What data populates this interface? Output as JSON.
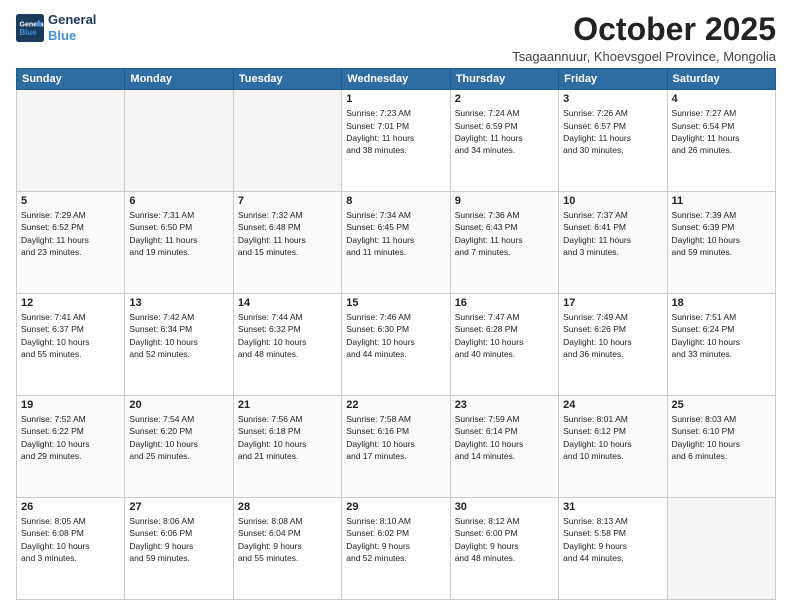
{
  "header": {
    "logo_line1": "General",
    "logo_line2": "Blue",
    "month_title": "October 2025",
    "location": "Tsagaannuur, Khoevsgoel Province, Mongolia"
  },
  "weekdays": [
    "Sunday",
    "Monday",
    "Tuesday",
    "Wednesday",
    "Thursday",
    "Friday",
    "Saturday"
  ],
  "weeks": [
    [
      {
        "day": "",
        "info": ""
      },
      {
        "day": "",
        "info": ""
      },
      {
        "day": "",
        "info": ""
      },
      {
        "day": "1",
        "info": "Sunrise: 7:23 AM\nSunset: 7:01 PM\nDaylight: 11 hours\nand 38 minutes."
      },
      {
        "day": "2",
        "info": "Sunrise: 7:24 AM\nSunset: 6:59 PM\nDaylight: 11 hours\nand 34 minutes."
      },
      {
        "day": "3",
        "info": "Sunrise: 7:26 AM\nSunset: 6:57 PM\nDaylight: 11 hours\nand 30 minutes."
      },
      {
        "day": "4",
        "info": "Sunrise: 7:27 AM\nSunset: 6:54 PM\nDaylight: 11 hours\nand 26 minutes."
      }
    ],
    [
      {
        "day": "5",
        "info": "Sunrise: 7:29 AM\nSunset: 6:52 PM\nDaylight: 11 hours\nand 23 minutes."
      },
      {
        "day": "6",
        "info": "Sunrise: 7:31 AM\nSunset: 6:50 PM\nDaylight: 11 hours\nand 19 minutes."
      },
      {
        "day": "7",
        "info": "Sunrise: 7:32 AM\nSunset: 6:48 PM\nDaylight: 11 hours\nand 15 minutes."
      },
      {
        "day": "8",
        "info": "Sunrise: 7:34 AM\nSunset: 6:45 PM\nDaylight: 11 hours\nand 11 minutes."
      },
      {
        "day": "9",
        "info": "Sunrise: 7:36 AM\nSunset: 6:43 PM\nDaylight: 11 hours\nand 7 minutes."
      },
      {
        "day": "10",
        "info": "Sunrise: 7:37 AM\nSunset: 6:41 PM\nDaylight: 11 hours\nand 3 minutes."
      },
      {
        "day": "11",
        "info": "Sunrise: 7:39 AM\nSunset: 6:39 PM\nDaylight: 10 hours\nand 59 minutes."
      }
    ],
    [
      {
        "day": "12",
        "info": "Sunrise: 7:41 AM\nSunset: 6:37 PM\nDaylight: 10 hours\nand 55 minutes."
      },
      {
        "day": "13",
        "info": "Sunrise: 7:42 AM\nSunset: 6:34 PM\nDaylight: 10 hours\nand 52 minutes."
      },
      {
        "day": "14",
        "info": "Sunrise: 7:44 AM\nSunset: 6:32 PM\nDaylight: 10 hours\nand 48 minutes."
      },
      {
        "day": "15",
        "info": "Sunrise: 7:46 AM\nSunset: 6:30 PM\nDaylight: 10 hours\nand 44 minutes."
      },
      {
        "day": "16",
        "info": "Sunrise: 7:47 AM\nSunset: 6:28 PM\nDaylight: 10 hours\nand 40 minutes."
      },
      {
        "day": "17",
        "info": "Sunrise: 7:49 AM\nSunset: 6:26 PM\nDaylight: 10 hours\nand 36 minutes."
      },
      {
        "day": "18",
        "info": "Sunrise: 7:51 AM\nSunset: 6:24 PM\nDaylight: 10 hours\nand 33 minutes."
      }
    ],
    [
      {
        "day": "19",
        "info": "Sunrise: 7:52 AM\nSunset: 6:22 PM\nDaylight: 10 hours\nand 29 minutes."
      },
      {
        "day": "20",
        "info": "Sunrise: 7:54 AM\nSunset: 6:20 PM\nDaylight: 10 hours\nand 25 minutes."
      },
      {
        "day": "21",
        "info": "Sunrise: 7:56 AM\nSunset: 6:18 PM\nDaylight: 10 hours\nand 21 minutes."
      },
      {
        "day": "22",
        "info": "Sunrise: 7:58 AM\nSunset: 6:16 PM\nDaylight: 10 hours\nand 17 minutes."
      },
      {
        "day": "23",
        "info": "Sunrise: 7:59 AM\nSunset: 6:14 PM\nDaylight: 10 hours\nand 14 minutes."
      },
      {
        "day": "24",
        "info": "Sunrise: 8:01 AM\nSunset: 6:12 PM\nDaylight: 10 hours\nand 10 minutes."
      },
      {
        "day": "25",
        "info": "Sunrise: 8:03 AM\nSunset: 6:10 PM\nDaylight: 10 hours\nand 6 minutes."
      }
    ],
    [
      {
        "day": "26",
        "info": "Sunrise: 8:05 AM\nSunset: 6:08 PM\nDaylight: 10 hours\nand 3 minutes."
      },
      {
        "day": "27",
        "info": "Sunrise: 8:06 AM\nSunset: 6:06 PM\nDaylight: 9 hours\nand 59 minutes."
      },
      {
        "day": "28",
        "info": "Sunrise: 8:08 AM\nSunset: 6:04 PM\nDaylight: 9 hours\nand 55 minutes."
      },
      {
        "day": "29",
        "info": "Sunrise: 8:10 AM\nSunset: 6:02 PM\nDaylight: 9 hours\nand 52 minutes."
      },
      {
        "day": "30",
        "info": "Sunrise: 8:12 AM\nSunset: 6:00 PM\nDaylight: 9 hours\nand 48 minutes."
      },
      {
        "day": "31",
        "info": "Sunrise: 8:13 AM\nSunset: 5:58 PM\nDaylight: 9 hours\nand 44 minutes."
      },
      {
        "day": "",
        "info": ""
      }
    ]
  ]
}
